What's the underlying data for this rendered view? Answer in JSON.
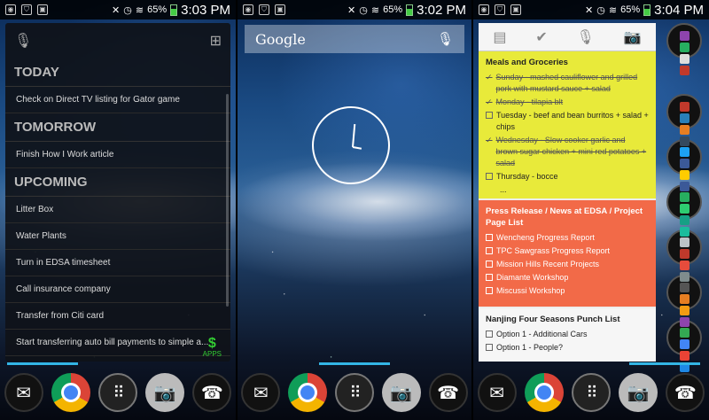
{
  "screens": [
    {
      "status": {
        "battery": "65%",
        "time": "3:03 PM"
      },
      "tasks": {
        "sections": [
          {
            "title": "TODAY",
            "items": [
              "Check on Direct TV listing for Gator game"
            ]
          },
          {
            "title": "TOMORROW",
            "items": [
              "Finish How I Work article"
            ]
          },
          {
            "title": "UPCOMING",
            "items": [
              "Litter Box",
              "Water Plants",
              "Turn in EDSA timesheet",
              "Call insurance company",
              "Transfer from Citi card",
              "Start transferring auto bill payments to simple a..."
            ]
          }
        ],
        "apps_label": "APPS"
      }
    },
    {
      "status": {
        "battery": "65%",
        "time": "3:02 PM"
      },
      "search": {
        "logo": "Google"
      }
    },
    {
      "status": {
        "battery": "65%",
        "time": "3:04 PM"
      },
      "notes": [
        {
          "title": "Meals and Groceries",
          "items": [
            {
              "text": "Sunday - mashed cauliflower and grilled pork with mustard sauce + salad",
              "done": true
            },
            {
              "text": "Monday - tilapia blt",
              "done": true
            },
            {
              "text": "Tuesday - beef and bean burritos + salad + chips",
              "done": false
            },
            {
              "text": "Wednesday - Slow cooker garlic and brown sugar chicken + mini red potatoes + salad",
              "done": true
            },
            {
              "text": "Thursday - bocce",
              "done": false
            }
          ],
          "more": "..."
        },
        {
          "title": "Press Release / News at EDSA / Project Page List",
          "items": [
            {
              "text": "Wencheng Progress Report",
              "done": false
            },
            {
              "text": "TPC Sawgrass Progress Report",
              "done": false
            },
            {
              "text": "Mission Hills Recent Projects",
              "done": false
            },
            {
              "text": "Diamante Workshop",
              "done": false
            },
            {
              "text": "Miscussi Workshop",
              "done": false
            }
          ]
        },
        {
          "title": "Nanjing Four Seasons Punch List",
          "items": [
            {
              "text": "Option 1 - Additional Cars",
              "done": false
            },
            {
              "text": "Option 1 - People?",
              "done": false
            }
          ]
        }
      ]
    }
  ]
}
